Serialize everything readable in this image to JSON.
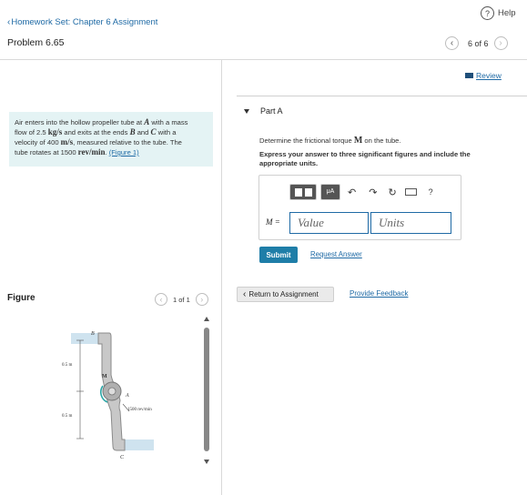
{
  "header": {
    "back_link": "Homework Set: Chapter 6 Assignment",
    "problem_title": "Problem 6.65",
    "help_label": "Help",
    "pager_text": "6 of 6"
  },
  "review_label": "Review",
  "problem_text": {
    "line1a": "Air enters into the hollow propeller tube at ",
    "line1b": "A",
    "line1c": " with a mass",
    "line2a": "flow of 2.5 ",
    "line2b": "kg/s",
    "line2c": " and exits at the ends ",
    "line2d": "B",
    "line2e": " and ",
    "line2f": "C",
    "line2g": " with a",
    "line3a": "velocity of 400 ",
    "line3b": "m/s",
    "line3c": ", measured relative to the tube. The",
    "line4a": "tube rotates at 1500 ",
    "line4b": "rev/min",
    "line4c": ". ",
    "figure_link": "(Figure 1)"
  },
  "figure": {
    "title": "Figure",
    "pager": "1 of 1",
    "label_B": "B",
    "label_M": "M",
    "label_A": "A",
    "label_C": "C",
    "dim_top": "0.5 m",
    "dim_bottom": "0.5 m",
    "speed": "1500 rev/min"
  },
  "part": {
    "label": "Part A",
    "question_a": "Determine the frictional torque ",
    "question_b": "M",
    "question_c": " on the tube.",
    "instructions": "Express your answer to three significant figures and include the appropriate units.",
    "toolbar_mu": "μA",
    "toolbar_help": "?",
    "var_label": "M =",
    "value_placeholder": "Value",
    "units_placeholder": "Units",
    "submit": "Submit",
    "request_answer": "Request Answer"
  },
  "footer": {
    "return_label": "Return to Assignment",
    "feedback_label": "Provide Feedback"
  },
  "colors": {
    "link": "#1f6aa5",
    "submit_bg": "#1f7ea8",
    "panel_bg": "#e4f3f4"
  }
}
